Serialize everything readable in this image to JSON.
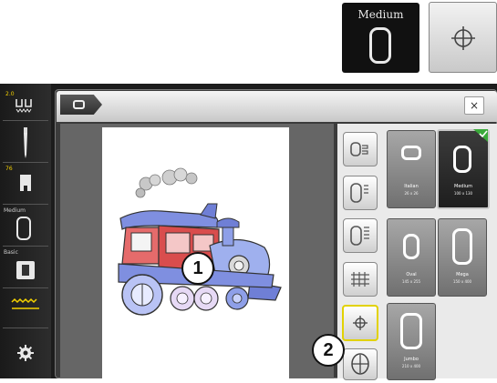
{
  "top_icons": {
    "hoop_label": "Medium"
  },
  "sidebar": {
    "top_value": "2.0",
    "hoop_number": "76",
    "hoop_label": "Medium",
    "bottom_label": "Basic"
  },
  "hoop_tiles": [
    {
      "label": "Italian",
      "size": "26 x 26"
    },
    {
      "label": "Medium",
      "size": "100 x 130"
    },
    {
      "label": "Oval",
      "size": "145 x 255"
    },
    {
      "label": "Mega",
      "size": "150 x 400"
    },
    {
      "label": "Jumbo",
      "size": "210 x 400"
    }
  ],
  "callouts": {
    "one": "1",
    "two": "2"
  },
  "colors": {
    "selection_outline": "#e2d200",
    "selected_check": "#3aa93a",
    "screen_bg": "#1c1c1c"
  }
}
